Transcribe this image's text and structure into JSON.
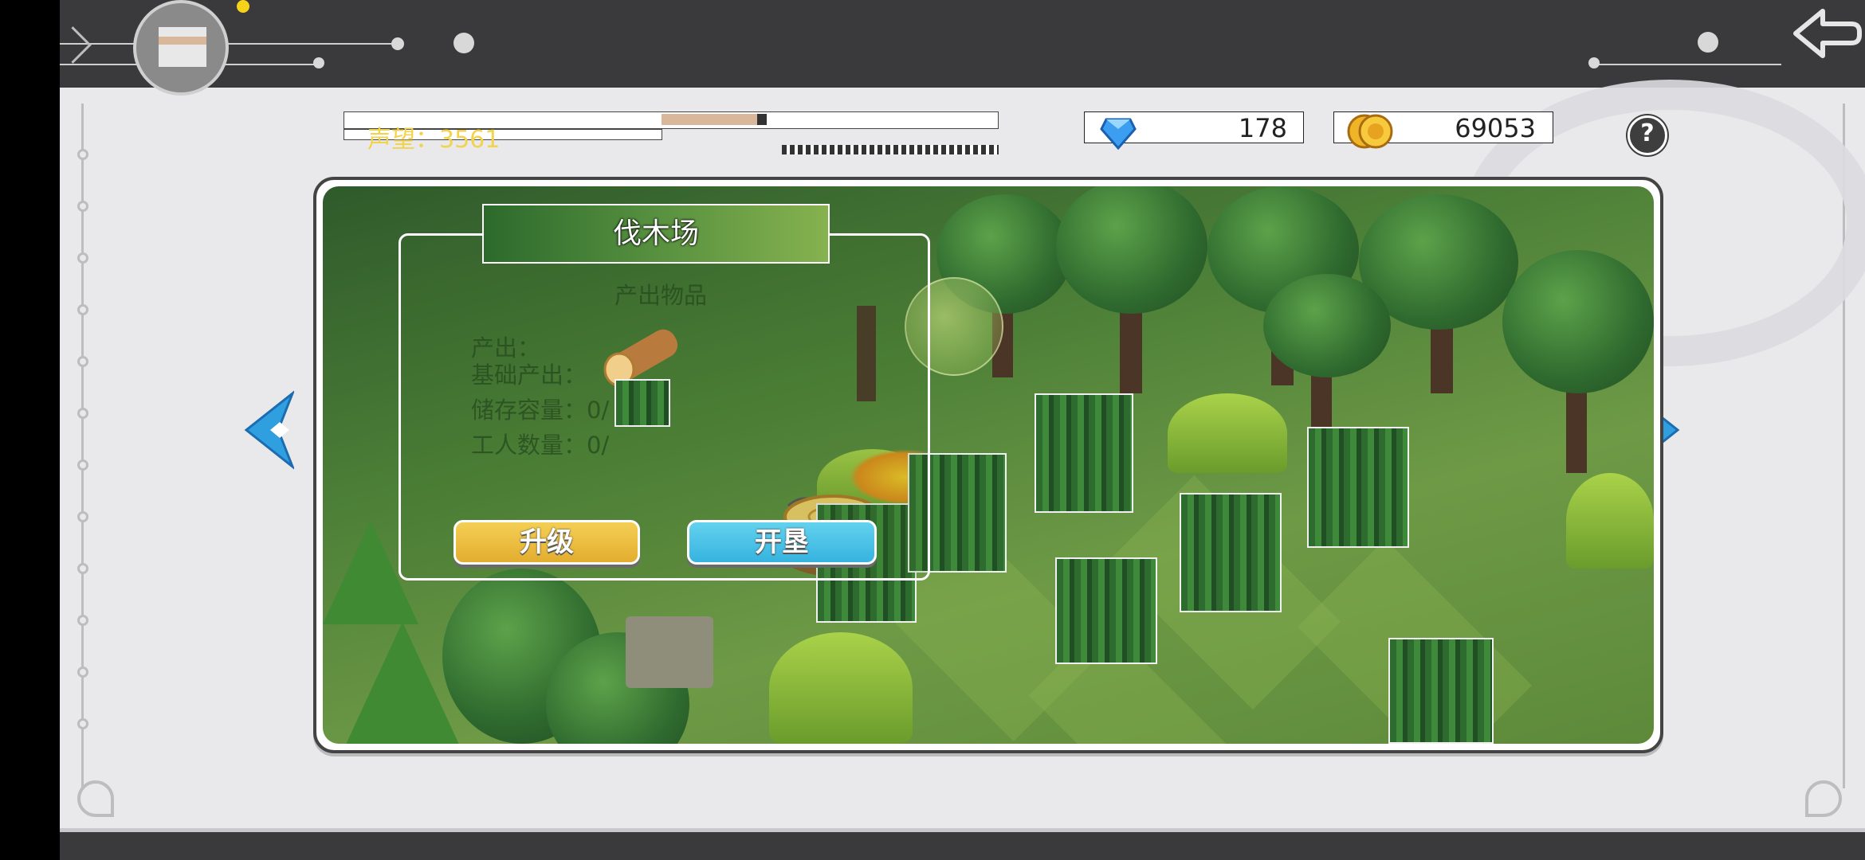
{
  "header": {
    "reputation_text": "声望：3561",
    "diamond_count": "178",
    "gold_count": "69053",
    "help_label": "?"
  },
  "panel": {
    "title": "伐木场",
    "lines": [
      "产出物品",
      "产出：",
      "基础产出：",
      "储存容量：0/",
      "工人数量：0/"
    ],
    "upgrade_label": "升级",
    "reclaim_label": "开垦"
  },
  "icons": {
    "back": "back-arrow-icon",
    "diamond": "diamond-icon",
    "gold": "gold-coin-icon",
    "help": "help-icon",
    "prev": "left-arrow-icon",
    "next": "right-arrow-icon"
  },
  "colors": {
    "topbar": "#3a3a3c",
    "background": "#e9e9eb",
    "upgrade_button": "#e9bb3d",
    "reclaim_button": "#45c0e7",
    "nav_arrow": "#2f9fe0",
    "reputation_text": "#f2d34c"
  }
}
